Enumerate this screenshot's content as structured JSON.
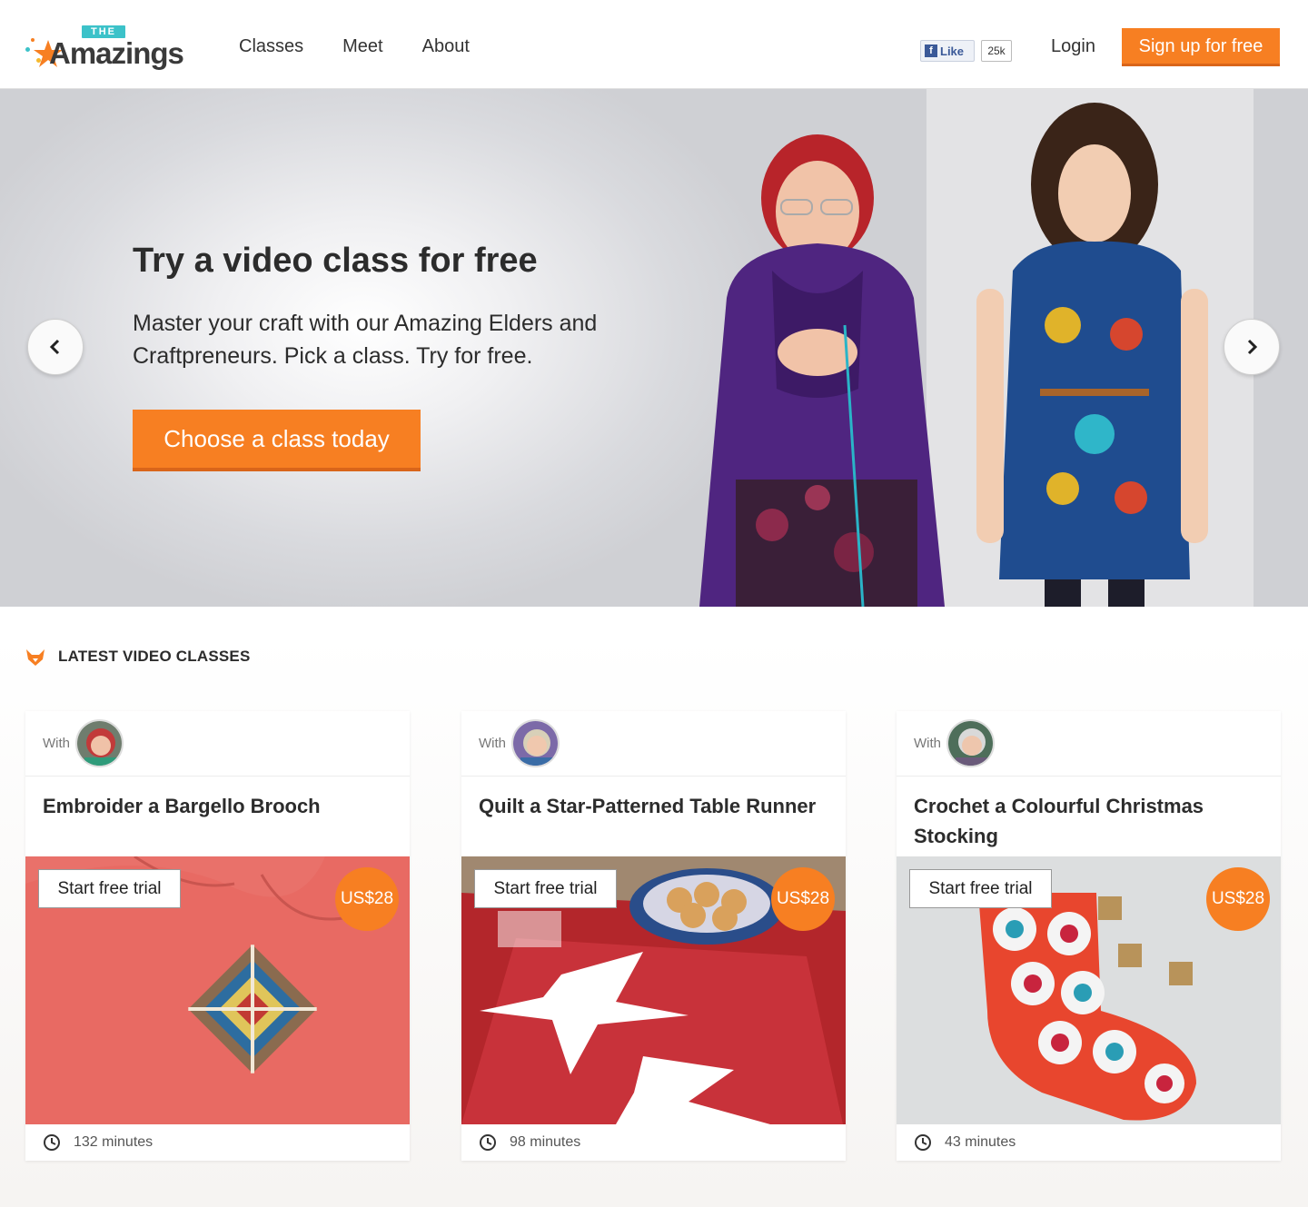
{
  "header": {
    "logo_tag": "THE",
    "logo_word": "Amazings",
    "nav": [
      "Classes",
      "Meet",
      "About"
    ],
    "fb_like_label": "Like",
    "fb_like_count": "25k",
    "login_label": "Login",
    "signup_label": "Sign up for free"
  },
  "hero": {
    "title": "Try a video class for free",
    "subtitle": "Master your craft with our Amazing Elders and Craftpreneurs. Pick a class. Try for free.",
    "cta_label": "Choose a class today",
    "prev_icon": "chevron-left-icon",
    "next_icon": "chevron-right-icon"
  },
  "latest": {
    "heading": "LATEST VIDEO CLASSES",
    "cards": [
      {
        "with_label": "With",
        "title": "Embroider a Bargello Brooch",
        "trial_label": "Start free trial",
        "price": "US$28",
        "duration": "132 minutes"
      },
      {
        "with_label": "With",
        "title": "Quilt a Star-Patterned Table Runner",
        "trial_label": "Start free trial",
        "price": "US$28",
        "duration": "98 minutes"
      },
      {
        "with_label": "With",
        "title": "Crochet a Colourful Christmas Stocking",
        "trial_label": "Start free trial",
        "price": "US$28",
        "duration": "43 minutes"
      }
    ]
  },
  "colors": {
    "accent": "#f77f22",
    "logo_teal": "#3cc2c9",
    "facebook": "#3b5998"
  }
}
